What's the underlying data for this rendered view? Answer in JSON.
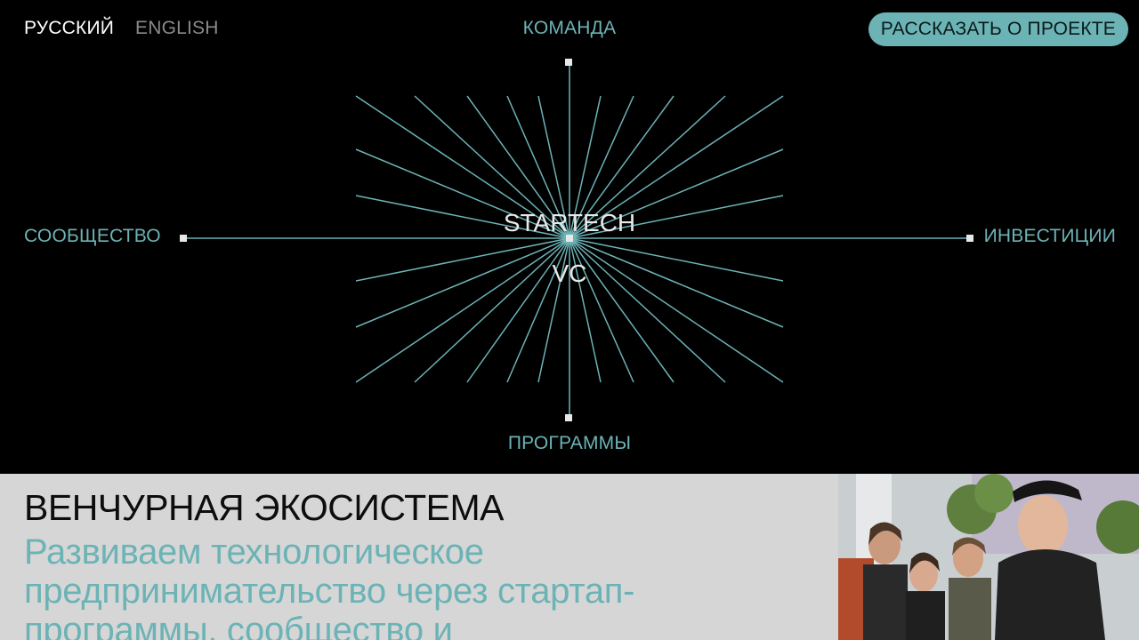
{
  "header": {
    "lang_ru": "РУССКИЙ",
    "lang_en": "ENGLISH",
    "cta_label": "РАССКАЗАТЬ О ПРОЕКТЕ"
  },
  "nav": {
    "team": "КОМАНДА",
    "community": "СООБЩЕСТВО",
    "investments": "ИНВЕСТИЦИИ",
    "programs": "ПРОГРАММЫ"
  },
  "logo": {
    "line1": "STARTECH",
    "line2": "VC"
  },
  "section": {
    "title": "ВЕНЧУРНАЯ ЭКОСИСТЕМА",
    "text": "Развиваем технологическое предпринимательство через стартап-программы, сообщество и"
  },
  "colors": {
    "accent": "#6cb3b6",
    "background": "#000000",
    "panel": "#d6d6d6",
    "active_lang": "#ffffff",
    "inactive_lang": "#8a8a8a"
  }
}
